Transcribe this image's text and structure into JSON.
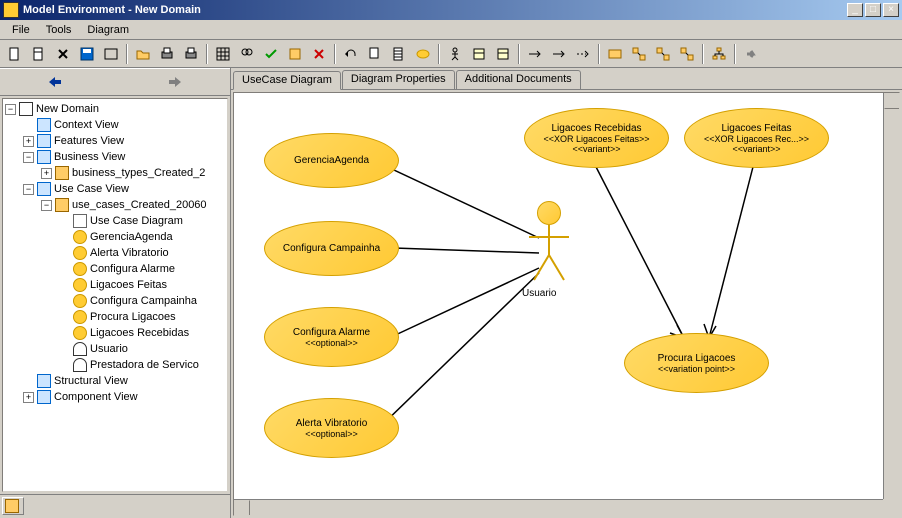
{
  "window": {
    "title": "Model Environment - New Domain"
  },
  "menu": {
    "file": "File",
    "tools": "Tools",
    "diagram": "Diagram"
  },
  "toolbar_icons": [
    "new-sheet-icon",
    "new-icon",
    "x-icon",
    "save-icon",
    "frame-icon",
    "open-icon",
    "print-icon",
    "printer-icon",
    "grid-icon",
    "find-icon",
    "check-icon",
    "box-icon",
    "delete-icon",
    "undo-icon",
    "copy-icon",
    "paste-icon",
    "circle-icon",
    "actor-icon",
    "class-icon",
    "dep-icon",
    "arrow1-icon",
    "arrow2-icon",
    "dash-arrow-icon",
    "mail-icon",
    "link1-icon",
    "link2-icon",
    "link3-icon",
    "org-icon",
    "fwd-icon"
  ],
  "tree": {
    "root": "New Domain",
    "context_view": "Context View",
    "features_view": "Features View",
    "business_view": "Business View",
    "business_types": "business_types_Created_2",
    "use_case_view": "Use Case View",
    "use_cases": "use_cases_Created_20060",
    "uc_diagram": "Use Case Diagram",
    "uc1": "GerenciaAgenda",
    "uc2": "Alerta Vibratorio",
    "uc3": "Configura Alarme",
    "uc4": "Ligacoes Feitas",
    "uc5": "Configura Campainha",
    "uc6": "Procura Ligacoes",
    "uc7": "Ligacoes Recebidas",
    "actor1": "Usuario",
    "actor2": "Prestadora de Servico",
    "structural_view": "Structural View",
    "component_view": "Component View"
  },
  "tabs": {
    "t1": "UseCase Diagram",
    "t2": "Diagram Properties",
    "t3": "Additional Documents"
  },
  "diagram": {
    "gerencia_agenda": "GerenciaAgenda",
    "configura_campainha": "Configura Campainha",
    "configura_alarme": "Configura Alarme",
    "configura_alarme_stereo": "<<optional>>",
    "alerta_vibratorio": "Alerta Vibratorio",
    "alerta_vibratorio_stereo": "<<optional>>",
    "ligacoes_recebidas": "Ligacoes Recebidas",
    "ligacoes_recebidas_stereo": "<<XOR Ligacoes Feitas>>",
    "ligacoes_recebidas_variant": "<<variant>>",
    "ligacoes_feitas": "Ligacoes Feitas",
    "ligacoes_feitas_stereo": "<<XOR Ligacoes Rec...>>",
    "ligacoes_feitas_variant": "<<variant>>",
    "procura_ligacoes": "Procura Ligacoes",
    "procura_ligacoes_stereo": "<<variation point>>",
    "actor_label": "Usuario"
  }
}
